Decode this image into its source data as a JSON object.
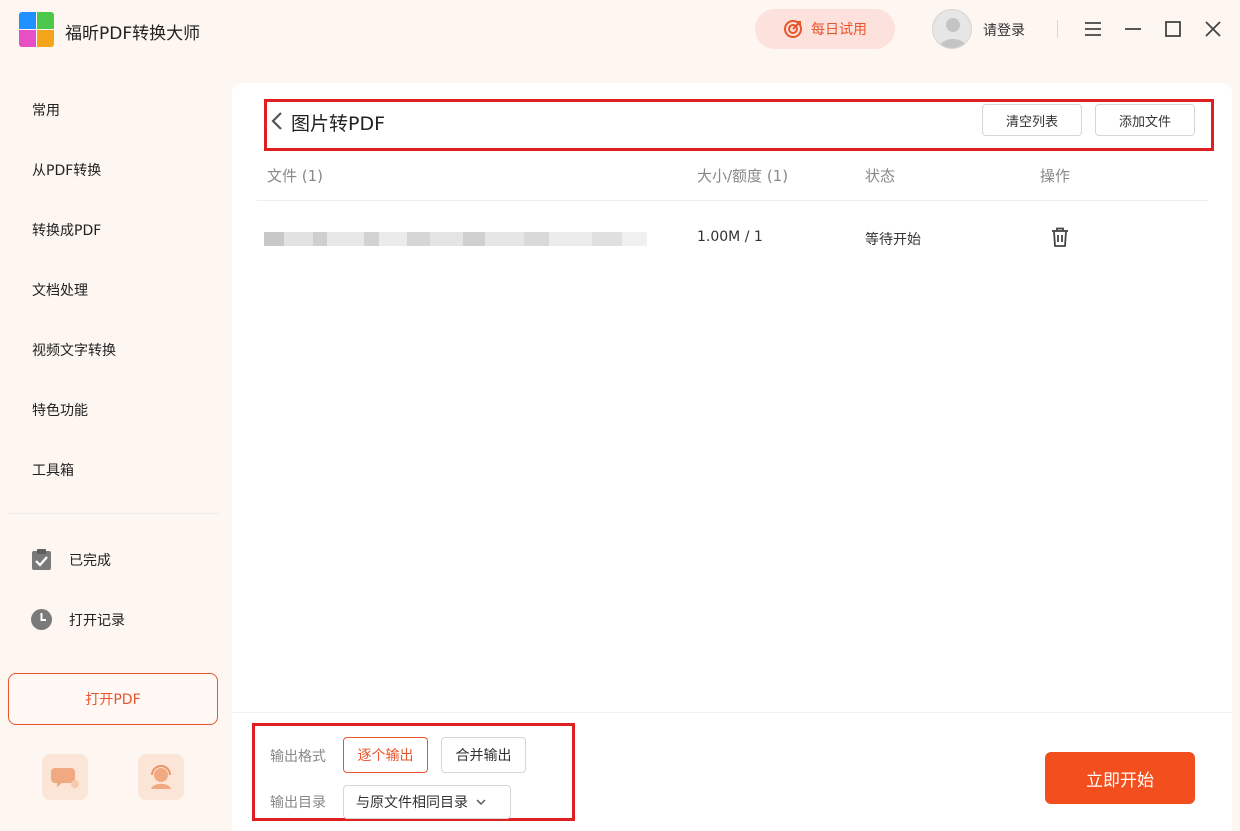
{
  "app": {
    "title": "福昕PDF转换大师"
  },
  "titlebar": {
    "trial_label": "每日试用",
    "login_label": "请登录"
  },
  "sidebar": {
    "items": [
      {
        "label": "常用"
      },
      {
        "label": "从PDF转换"
      },
      {
        "label": "转换成PDF"
      },
      {
        "label": "文档处理"
      },
      {
        "label": "视频文字转换"
      },
      {
        "label": "特色功能"
      },
      {
        "label": "工具箱"
      }
    ],
    "completed_label": "已完成",
    "history_label": "打开记录",
    "open_pdf_label": "打开PDF"
  },
  "main": {
    "title": "图片转PDF",
    "clear_label": "清空列表",
    "add_label": "添加文件",
    "columns": {
      "file": "文件 (1)",
      "size": "大小/额度 (1)",
      "status": "状态",
      "action": "操作"
    },
    "rows": [
      {
        "size": "1.00M / 1",
        "status": "等待开始"
      }
    ]
  },
  "bottom": {
    "format_label": "输出格式",
    "format_options": [
      "逐个输出",
      "合并输出"
    ],
    "format_selected": "逐个输出",
    "dir_label": "输出目录",
    "dir_value": "与原文件相同目录",
    "start_label": "立即开始"
  },
  "colors": {
    "accent": "#e8552d",
    "start_button": "#f24e1e",
    "highlight_box": "#e02020",
    "background": "#fdf6f1"
  }
}
